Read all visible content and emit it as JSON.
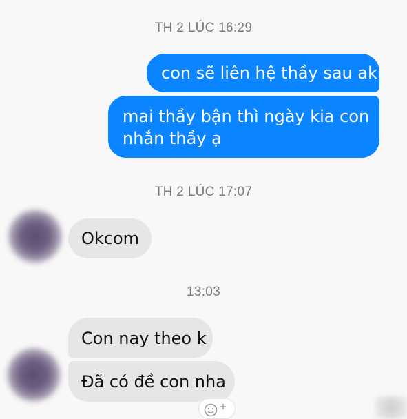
{
  "conversation": {
    "timestamps": {
      "first": "TH 2 LÚC 16:29",
      "second": "TH 2 LÚC 17:07",
      "third": "13:03"
    },
    "outgoing": {
      "msg1": "con sẽ liên hệ thầy sau ak",
      "msg2_line1": "mai thầy bận thì ngày kia con",
      "msg2_line2": "nhắn thầy ạ"
    },
    "incoming": {
      "msg1": "Okcom",
      "msg2": "Con nay theo k",
      "msg3": "Đã có đề con nha"
    }
  },
  "colors": {
    "outgoing_bubble": "#0a84ff",
    "incoming_bubble": "#e6e6e6",
    "background": "#f8f8f8",
    "timestamp_text": "#7a7a7a"
  },
  "icons": {
    "reaction": "add-reaction-icon",
    "avatar": "contact-avatar"
  }
}
